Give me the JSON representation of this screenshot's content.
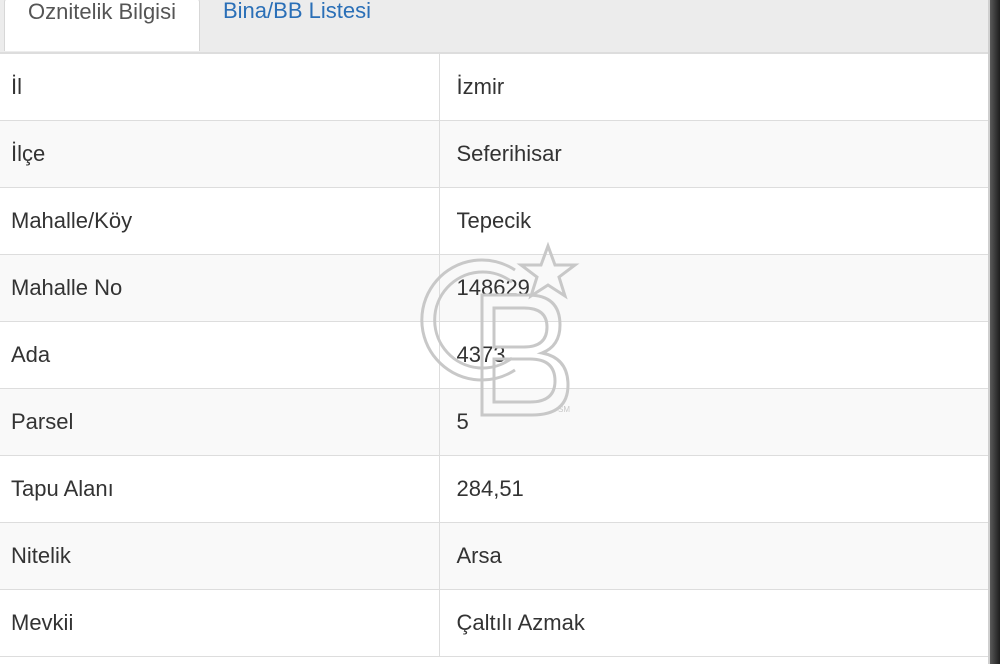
{
  "tabs": [
    {
      "label": "Oznitelik Bilgisi",
      "active": true
    },
    {
      "label": "Bina/BB Listesi",
      "active": false
    }
  ],
  "rows": [
    {
      "key": "İl",
      "value": "İzmir"
    },
    {
      "key": "İlçe",
      "value": "Seferihisar"
    },
    {
      "key": "Mahalle/Köy",
      "value": "Tepecik"
    },
    {
      "key": "Mahalle No",
      "value": "148629"
    },
    {
      "key": "Ada",
      "value": "4373"
    },
    {
      "key": "Parsel",
      "value": "5"
    },
    {
      "key": "Tapu Alanı",
      "value": "284,51"
    },
    {
      "key": "Nitelik",
      "value": "Arsa"
    },
    {
      "key": "Mevkii",
      "value": "Çaltılı Azmak"
    }
  ],
  "watermark": {
    "text": "CB",
    "mark": "SM",
    "icon": "star-icon",
    "color": "#c8c8c8"
  },
  "colors": {
    "link": "#2a6fb7",
    "border": "#dddddd",
    "stripe": "#f9f9f9",
    "tabbar": "#ececec"
  }
}
